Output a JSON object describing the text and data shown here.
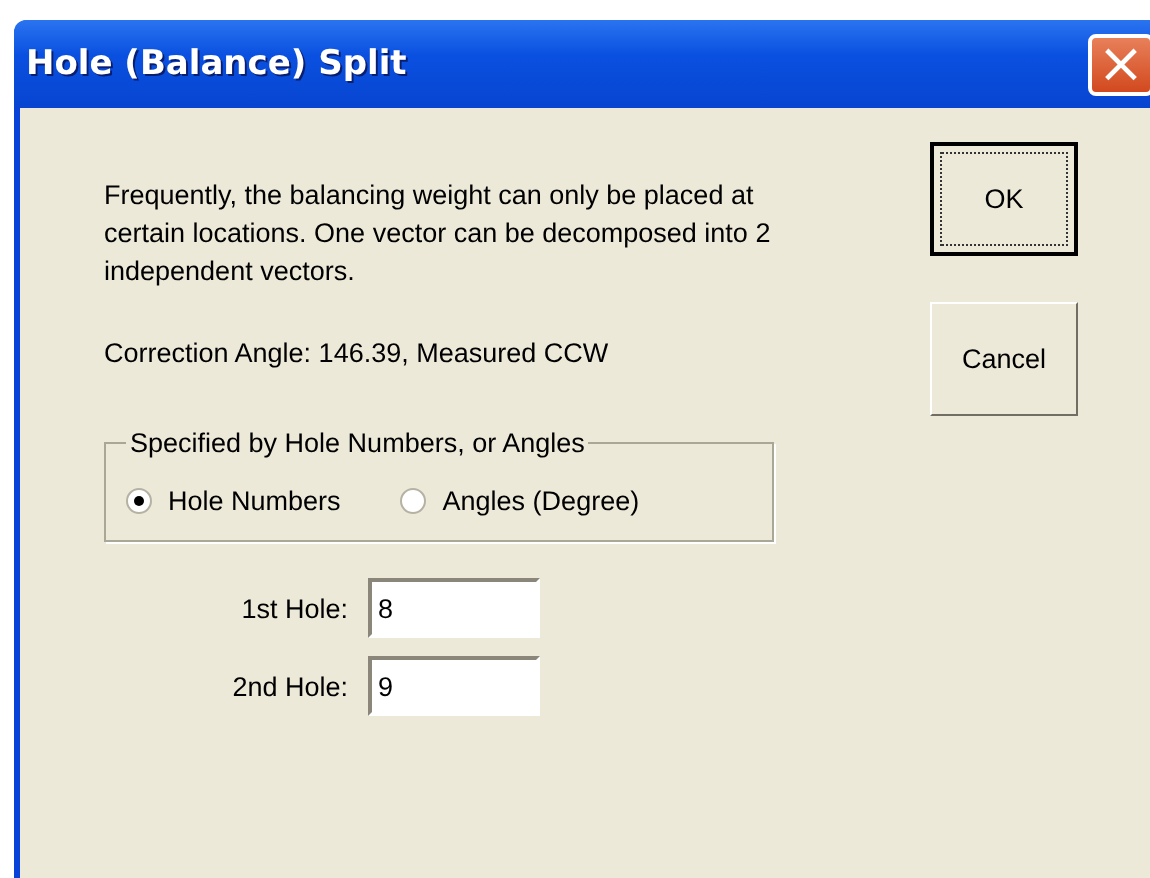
{
  "window": {
    "title": "Hole (Balance) Split",
    "close": "×"
  },
  "description": "Frequently, the balancing weight can only be  placed at certain  locations.  One vector can be decomposed into 2 independent vectors.",
  "correction": "Correction Angle: 146.39, Measured  CCW",
  "group": {
    "title": "Specified by Hole Numbers, or Angles",
    "options": [
      {
        "label": "Hole Numbers",
        "selected": true
      },
      {
        "label": "Angles (Degree)",
        "selected": false
      }
    ]
  },
  "fields": [
    {
      "label": "1st Hole:",
      "value": "8"
    },
    {
      "label": "2nd Hole:",
      "value": "9"
    }
  ],
  "buttons": [
    {
      "label": "OK",
      "default": true
    },
    {
      "label": "Cancel",
      "default": false
    }
  ]
}
